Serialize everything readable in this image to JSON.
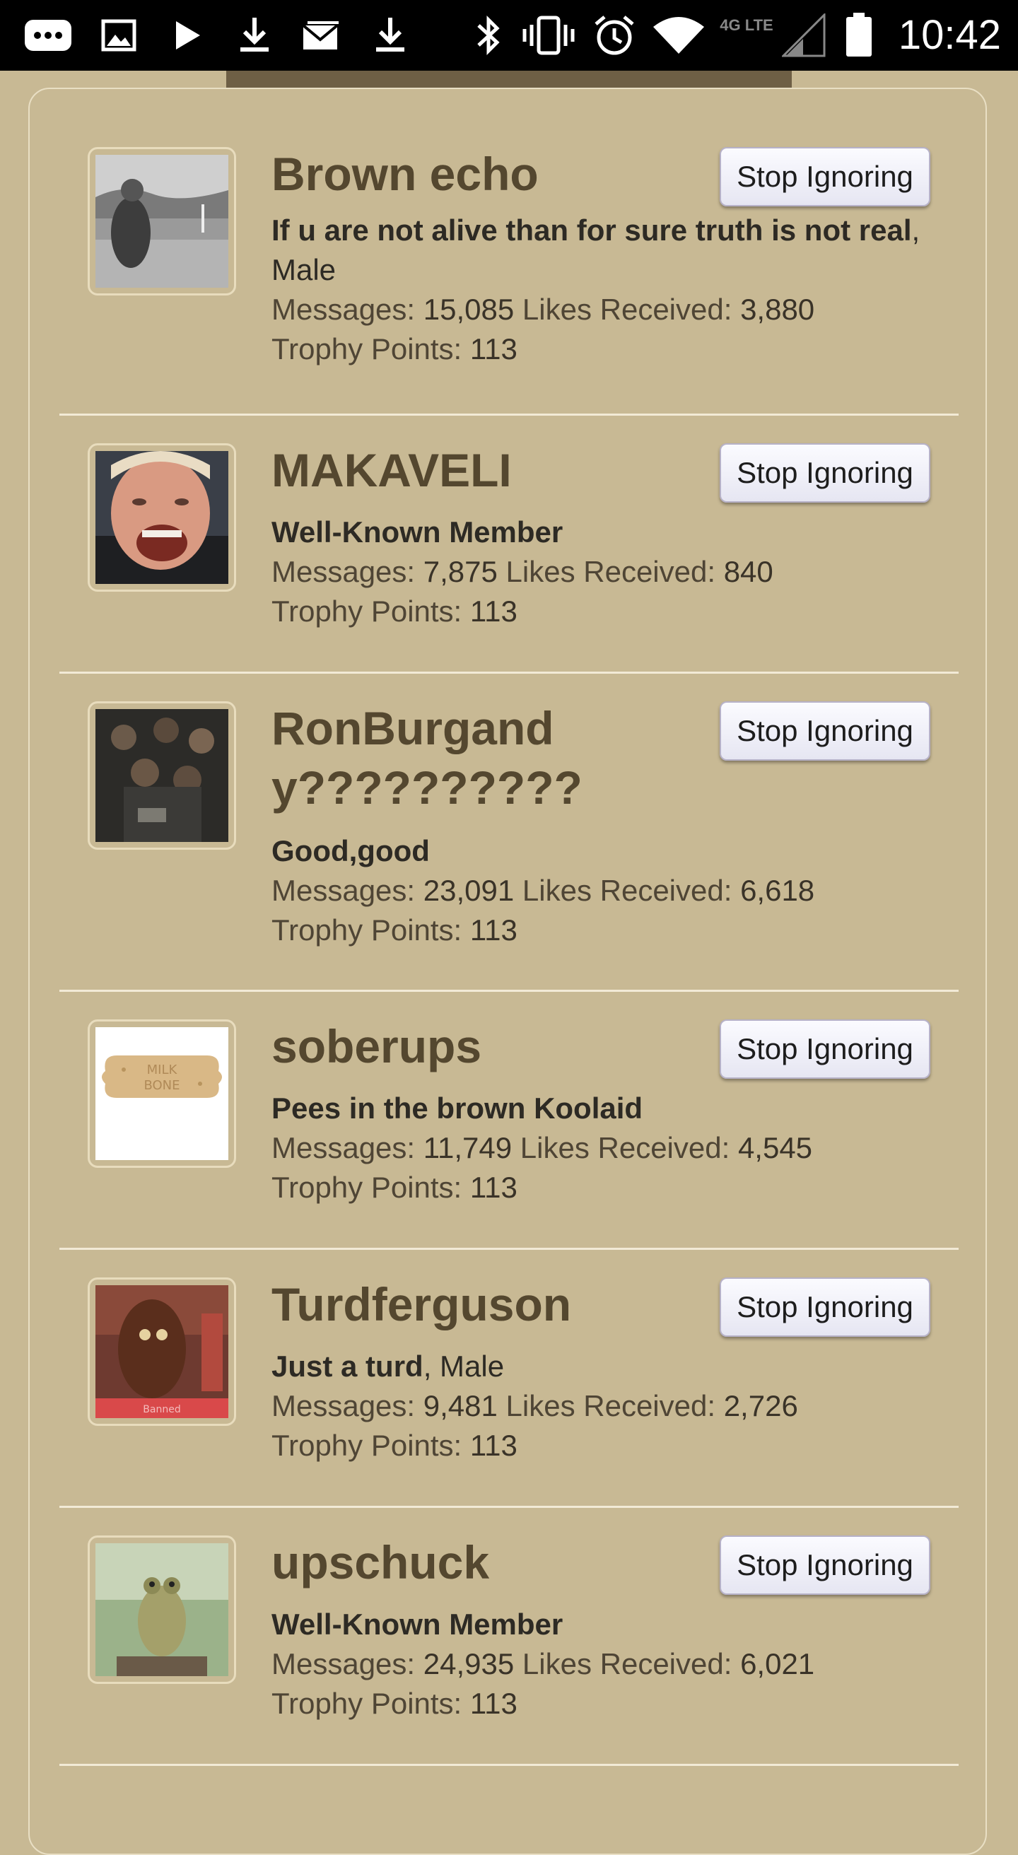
{
  "status_bar": {
    "time": "10:42",
    "network": "4G LTE",
    "icons": [
      "more-icon",
      "image-icon",
      "play-icon",
      "download-icon",
      "mail-icon",
      "download-icon",
      "bluetooth-icon",
      "vibrate-icon",
      "alarm-icon",
      "wifi-icon",
      "signal-icon",
      "battery-icon"
    ]
  },
  "members": [
    {
      "name": "Brown echo",
      "title": "If u are not alive than for sure truth is not real",
      "extra": ", Male",
      "messages_label": "Messages:",
      "messages": "15,085",
      "likes_label": "Likes Received:",
      "likes": "3,880",
      "trophy_label": "Trophy Points:",
      "trophy": "113",
      "button": "Stop Ignoring"
    },
    {
      "name": "MAKAVELI",
      "title": "Well-Known Member",
      "extra": "",
      "messages_label": "Messages:",
      "messages": "7,875",
      "likes_label": "Likes Received:",
      "likes": "840",
      "trophy_label": "Trophy Points:",
      "trophy": "113",
      "button": "Stop Ignoring"
    },
    {
      "name": "RonBurgandy??????????",
      "title": "Good,good",
      "extra": "",
      "messages_label": "Messages:",
      "messages": "23,091",
      "likes_label": "Likes Received:",
      "likes": "6,618",
      "trophy_label": "Trophy Points:",
      "trophy": "113",
      "button": "Stop Ignoring"
    },
    {
      "name": "soberups",
      "title": "Pees in the brown Koolaid",
      "extra": "",
      "messages_label": "Messages:",
      "messages": "11,749",
      "likes_label": "Likes Received:",
      "likes": "4,545",
      "trophy_label": "Trophy Points:",
      "trophy": "113",
      "button": "Stop Ignoring"
    },
    {
      "name": "Turdferguson",
      "title": "Just a turd",
      "extra": ", Male",
      "messages_label": "Messages:",
      "messages": "9,481",
      "likes_label": "Likes Received:",
      "likes": "2,726",
      "trophy_label": "Trophy Points:",
      "trophy": "113",
      "button": "Stop Ignoring"
    },
    {
      "name": "upschuck",
      "title": "Well-Known Member",
      "extra": "",
      "messages_label": "Messages:",
      "messages": "24,935",
      "likes_label": "Likes Received:",
      "likes": "6,021",
      "trophy_label": "Trophy Points:",
      "trophy": "113",
      "button": "Stop Ignoring"
    }
  ],
  "avatar_images": [
    "grayscale-photo-avatar",
    "shouting-man-avatar",
    "group-photo-avatar",
    "milk-bone-avatar",
    "stuffed-mascot-avatar",
    "frog-avatar"
  ],
  "colors": {
    "background": "#c8b994",
    "name_text": "#54472f",
    "divider": "#f2ead6"
  }
}
